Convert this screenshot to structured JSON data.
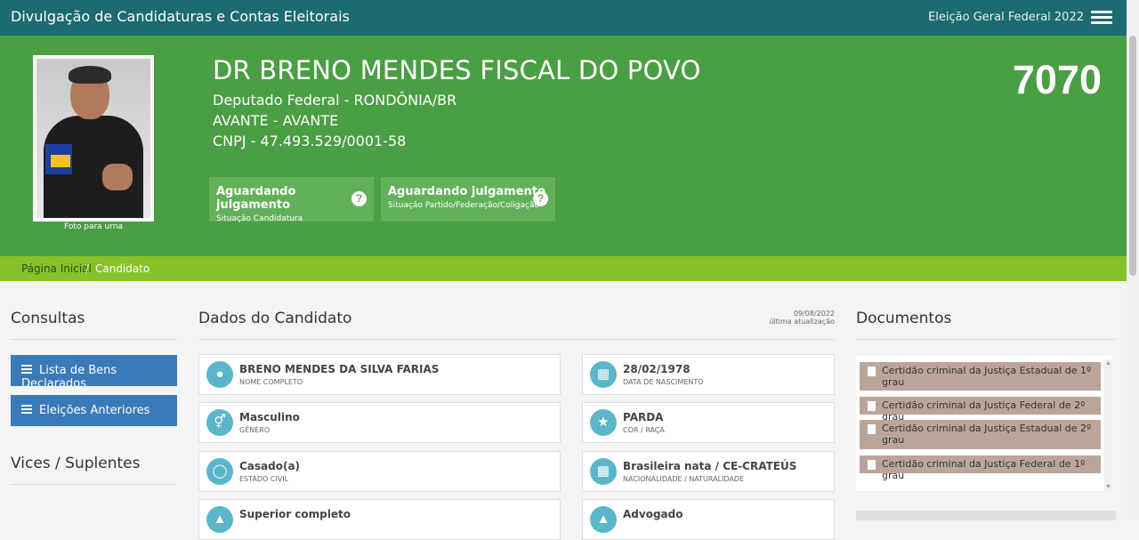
{
  "header": {
    "site_title": "Divulgação de Candidaturas e Contas Eleitorais",
    "election": "Eleição Geral Federal 2022"
  },
  "candidate": {
    "photo_caption": "Foto para urna",
    "name": "DR BRENO MENDES FISCAL DO POVO",
    "office": "Deputado Federal - RONDÔNIA/BR",
    "party": "AVANTE - AVANTE",
    "cnpj": "CNPJ - 47.493.529/0001-58",
    "number": "7070",
    "status_candidacy": {
      "title": "Aguardando julgamento",
      "sub": "Situação Candidatura"
    },
    "status_party": {
      "title": "Aguardando julgamento",
      "sub": "Situação Partido/Federação/Coligação"
    }
  },
  "breadcrumb": {
    "home": "Página Inicial",
    "separator": "/",
    "current": "Candidato"
  },
  "sidebar": {
    "consultas_title": "Consultas",
    "buttons": [
      "Lista de Bens Declarados",
      "Eleições Anteriores"
    ],
    "vices_title": "Vices / Suplentes"
  },
  "main": {
    "title": "Dados do Candidato",
    "update_date": "09/08/2022",
    "update_label": "última atualização",
    "cards": [
      {
        "value": "BRENO MENDES DA SILVA FARIAS",
        "label": "NOME COMPLETO",
        "icon": "person-icon"
      },
      {
        "value": "28/02/1978",
        "label": "DATA DE NASCIMENTO",
        "icon": "calendar-icon"
      },
      {
        "value": "Masculino",
        "label": "GÊNERO",
        "icon": "gender-icon"
      },
      {
        "value": "PARDA",
        "label": "COR / RAÇA",
        "icon": "figure-icon"
      },
      {
        "value": "Casado(a)",
        "label": "ESTADO CIVIL",
        "icon": "ring-icon"
      },
      {
        "value": "Brasileira nata / CE-CRATEÚS",
        "label": "NACIONALIDADE / NATURALIDADE",
        "icon": "map-icon"
      },
      {
        "value": "Superior completo",
        "label": "",
        "icon": "graduation-cap-icon"
      },
      {
        "value": "Advogado",
        "label": "",
        "icon": "building-icon"
      }
    ]
  },
  "documents": {
    "title": "Documentos",
    "items": [
      "Certidão criminal da Justiça Estadual de 1º grau",
      "Certidão criminal da Justiça Federal de 2º grau",
      "Certidão criminal da Justiça Estadual de 2º grau",
      "Certidão criminal da Justiça Federal de 1º grau"
    ]
  }
}
